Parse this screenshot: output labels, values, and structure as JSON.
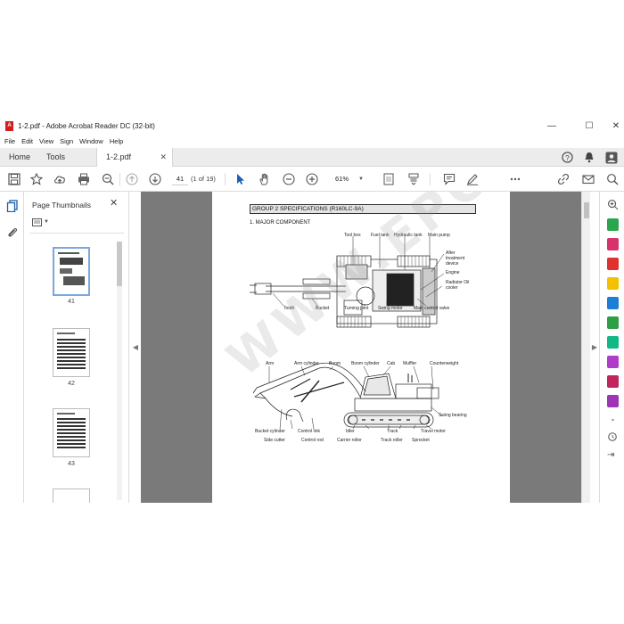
{
  "window": {
    "title": "1-2.pdf - Adobe Acrobat Reader DC (32-bit)",
    "minimize": "—",
    "maximize": "☐",
    "close": "✕"
  },
  "menu": [
    "File",
    "Edit",
    "View",
    "Sign",
    "Window",
    "Help"
  ],
  "tabs": {
    "home": "Home",
    "tools": "Tools",
    "document": "1-2.pdf",
    "document_close": "✕"
  },
  "toolbar": {
    "page_number": "41",
    "page_count": "(1 of 19)",
    "zoom": "61%"
  },
  "thumbnails": {
    "title": "Page Thumbnails",
    "pages": [
      "41",
      "42",
      "43"
    ]
  },
  "document": {
    "group_heading": "GROUP 2 SPECIFICATIONS (R160LC-9A)",
    "section_heading": "1. MAJOR COMPONENT",
    "watermark": "WWW.EPCDATA.COM",
    "top_view_labels": {
      "tool_box": "Tool box",
      "fuel_tank": "Fuel tank",
      "hydraulic_tank": "Hydraulic tank",
      "main_pump": "Main pump",
      "after_treatment": "After treatment device",
      "engine": "Engine",
      "radiator": "Radiator Oil cooler",
      "tooth": "Tooth",
      "bucket": "Bucket",
      "turning_joint": "Turning joint",
      "swing_motor": "Swing motor",
      "main_control_valve": "Main control valve"
    },
    "side_view_labels": {
      "arm": "Arm",
      "arm_cylinder": "Arm cylinder",
      "boom": "Boom",
      "boom_cylinder": "Boom cylinder",
      "cab": "Cab",
      "muffler": "Muffler",
      "counterweight": "Counterweight",
      "swing_bearing": "Swing bearing",
      "bucket_cylinder": "Bucket cylinder",
      "side_cutter": "Side cutter",
      "control_link": "Control link",
      "control_rod": "Control rod",
      "idler": "Idler",
      "carrier_roller": "Carrier roller",
      "track": "Track",
      "track_roller": "Track roller",
      "travel_motor": "Travel motor",
      "sprocket": "Sprocket"
    }
  }
}
